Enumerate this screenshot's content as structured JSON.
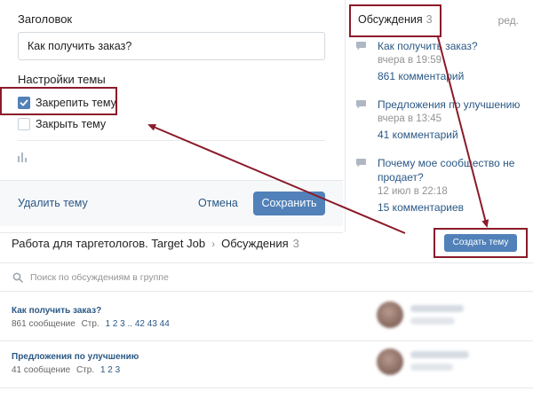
{
  "form": {
    "title_label": "Заголовок",
    "title_value": "Как получить заказ?",
    "settings_label": "Настройки темы",
    "pin_label": "Закрепить тему",
    "pin_checked": true,
    "close_label": "Закрыть тему",
    "close_checked": false,
    "delete_label": "Удалить тему",
    "cancel_label": "Отмена",
    "save_label": "Сохранить"
  },
  "discussions": {
    "header": "Обсуждения",
    "count": "3",
    "edit_label": "ред.",
    "items": [
      {
        "title": "Как получить заказ?",
        "date": "вчера в 19:59",
        "comments": "861 комментарий"
      },
      {
        "title": "Предложения по улучшению",
        "date": "вчера в 13:45",
        "comments": "41 комментарий"
      },
      {
        "title": "Почему мое сообщество не продает?",
        "date": "12 июл в 22:18",
        "comments": "15 комментариев"
      }
    ]
  },
  "board": {
    "group_name": "Работа для таргетологов. Target Job",
    "section": "Обсуждения",
    "count": "3",
    "create_label": "Создать тему",
    "search_placeholder": "Поиск по обсуждениям в группе",
    "topics": [
      {
        "title": "Как получить заказ?",
        "posts": "861 сообщение",
        "pages_label": "Стр.",
        "pages": "1 2 3 .. 42 43 44"
      },
      {
        "title": "Предложения по улучшению",
        "posts": "41 сообщение",
        "pages_label": "Стр.",
        "pages": "1 2 3"
      }
    ]
  },
  "colors": {
    "accent": "#5181b8",
    "link": "#2a5885",
    "annotation": "#8b1a2a"
  }
}
